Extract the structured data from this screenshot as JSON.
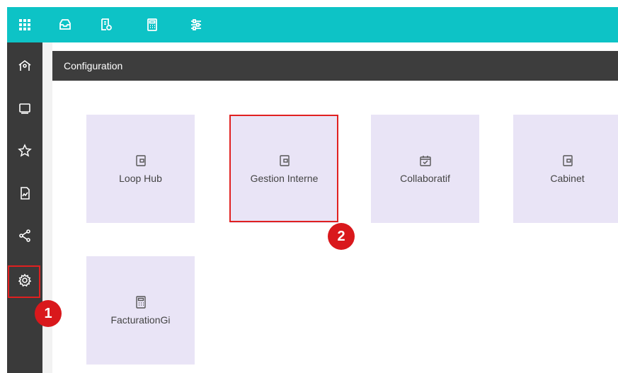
{
  "topbar": {
    "icons": [
      "apps-grid-icon",
      "inbox-icon",
      "document-settings-icon",
      "calculator-icon",
      "sliders-icon"
    ]
  },
  "sidebar": {
    "icons": [
      "home-icon",
      "folder-icon",
      "star-icon",
      "report-icon",
      "share-icon",
      "gear-icon"
    ]
  },
  "header": {
    "title": "Configuration"
  },
  "tiles": [
    {
      "label": "Loop Hub",
      "icon": "wallet-icon"
    },
    {
      "label": "Gestion Interne",
      "icon": "wallet-icon"
    },
    {
      "label": "Collaboratif",
      "icon": "calendar-check-icon"
    },
    {
      "label": "Cabinet",
      "icon": "wallet-icon"
    },
    {
      "label": "FacturationGi",
      "icon": "calculator-icon"
    }
  ],
  "annotations": {
    "step1": "1",
    "step2": "2"
  },
  "colors": {
    "topbar": "#0dc3c6",
    "sidebar": "#3a3a3a",
    "tile": "#e9e4f6",
    "highlight": "#e02020",
    "badge": "#d9181c"
  }
}
